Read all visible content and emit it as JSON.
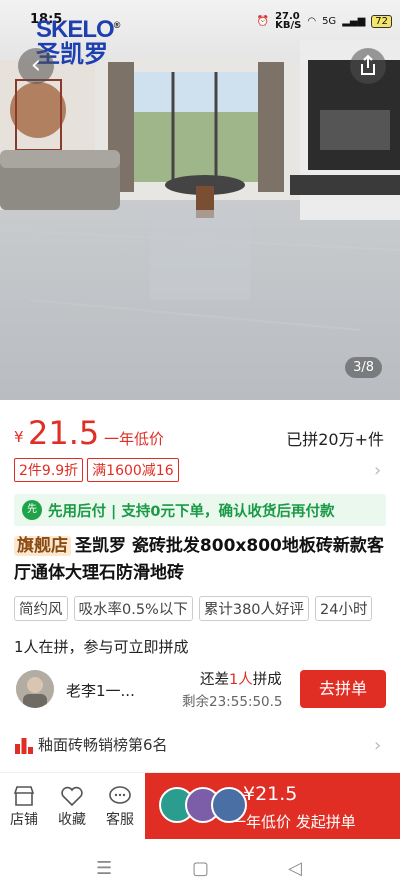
{
  "status_bar": {
    "time": "18:5",
    "network_speed": "27.0\nKB/S",
    "signal": "5G",
    "battery": "72"
  },
  "brand": {
    "logo_en": "SKELO",
    "logo_cn": "圣凯罗",
    "registered": "®"
  },
  "gallery": {
    "counter": "3/8"
  },
  "price": {
    "currency": "¥",
    "value": "21.5",
    "note": "一年低价",
    "sold": "已拼20万+件"
  },
  "coupons": [
    "2件9.9折",
    "满1600减16"
  ],
  "pay_banner": {
    "badge": "先",
    "text": "先用后付 | 支持0元下单，确认收货后再付款"
  },
  "product": {
    "store_tag": "旗舰店",
    "title": "圣凯罗 瓷砖批发800x800地板砖新款客厅通体大理石防滑地砖"
  },
  "tags": [
    "简约风",
    "吸水率0.5%以下",
    "累计380人好评",
    "24小时"
  ],
  "group": {
    "info": "1人在拼，参与可立即拼成",
    "user_name": "老李1一...",
    "remain_prefix": "还差",
    "remain_count": "1人",
    "remain_suffix": "拼成",
    "countdown": "剩余23:55:50.5",
    "join_label": "去拼单"
  },
  "rank": {
    "text": "釉面砖畅销榜第6名"
  },
  "bottom_bar": {
    "store": "店铺",
    "favorite": "收藏",
    "service": "客服",
    "buy_price": "¥21.5",
    "buy_note": "一年低价 发起拼单"
  },
  "colors": {
    "accent": "#e02e24",
    "pay_green": "#1a9a45"
  }
}
